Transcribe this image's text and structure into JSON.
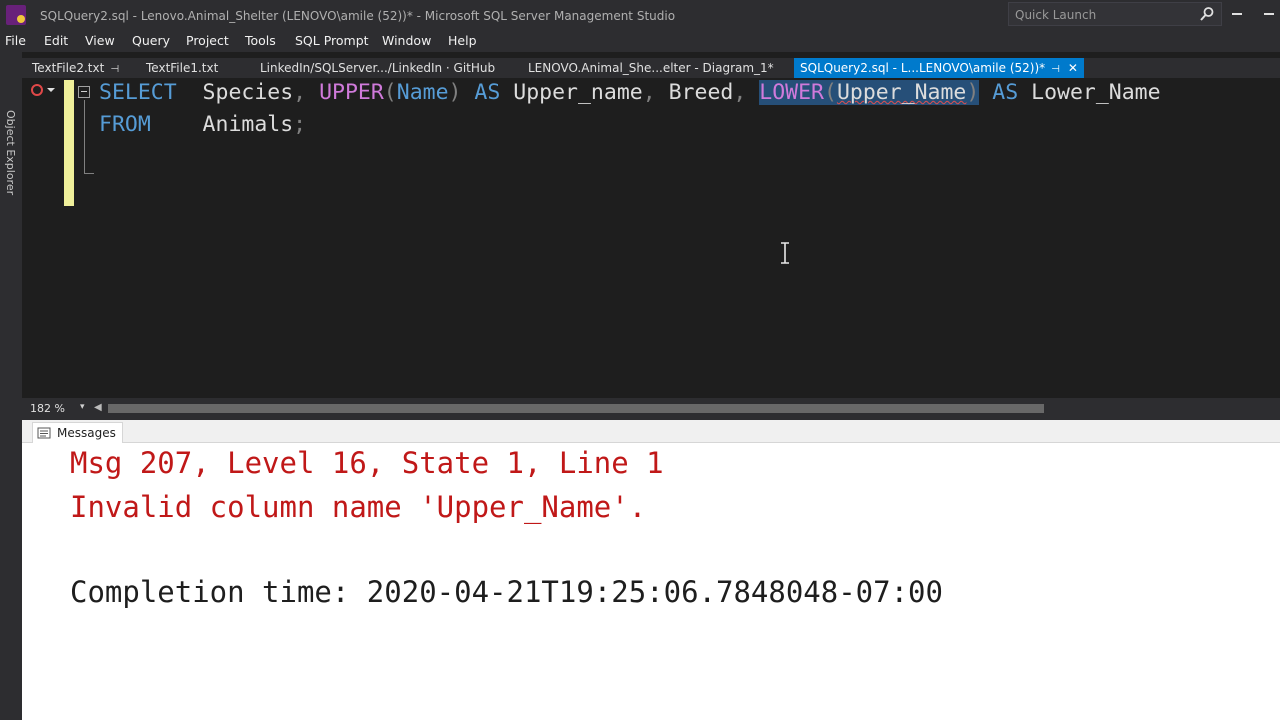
{
  "window": {
    "title": "SQLQuery2.sql - Lenovo.Animal_Shelter (LENOVO\\amile (52))* - Microsoft SQL Server Management Studio",
    "quick_launch_placeholder": "Quick Launch"
  },
  "menu": [
    "File",
    "Edit",
    "View",
    "Query",
    "Project",
    "Tools",
    "SQL Prompt",
    "Window",
    "Help"
  ],
  "tabs": [
    {
      "label": "TextFile2.txt",
      "pinned": true,
      "active": false
    },
    {
      "label": "TextFile1.txt",
      "pinned": false,
      "active": false
    },
    {
      "label": "LinkedIn/SQLServer.../LinkedIn · GitHub",
      "pinned": false,
      "active": false
    },
    {
      "label": "LENOVO.Animal_She...elter - Diagram_1*",
      "pinned": false,
      "active": false
    },
    {
      "label": "SQLQuery2.sql - L...LENOVO\\amile (52))*",
      "pinned": true,
      "active": true
    }
  ],
  "side_panel": {
    "label": "Object Explorer"
  },
  "editor": {
    "line1": {
      "t1": "SELECT",
      "t2": "  Species",
      "t3": ",",
      "t4": " UPPER",
      "t5": "(",
      "t6": "Name",
      "t7": ")",
      "t8": " AS",
      "t9": " Upper_name",
      "t10": ",",
      "t11": " Breed",
      "t12": ",",
      "t13": " ",
      "t14": "LOWER",
      "t15": "(",
      "t16": "Upper_Name",
      "t17": ")",
      "t18": " AS",
      "t19": " Lower_Name"
    },
    "line2": {
      "t1": "FROM",
      "t2": "    Animals",
      "t3": ";"
    }
  },
  "status": {
    "zoom": "182 %"
  },
  "results": {
    "tab_label": "Messages",
    "error_line1": "Msg 207, Level 16, State 1, Line 1",
    "error_line2": "Invalid column name 'Upper_Name'.",
    "completion": "Completion time: 2020-04-21T19:25:06.7848048-07:00"
  },
  "colors": {
    "keyword": "#569cd6",
    "function": "#d07adb",
    "error_text": "#c01818",
    "accent": "#007acc",
    "selection": "#264f78"
  },
  "icons": [
    "ssms-app-icon",
    "search-icon",
    "minimize-icon",
    "maximize-icon",
    "pin-icon",
    "close-icon",
    "sql-prompt-icon",
    "collapse-icon",
    "text-cursor-icon",
    "messages-icon"
  ]
}
